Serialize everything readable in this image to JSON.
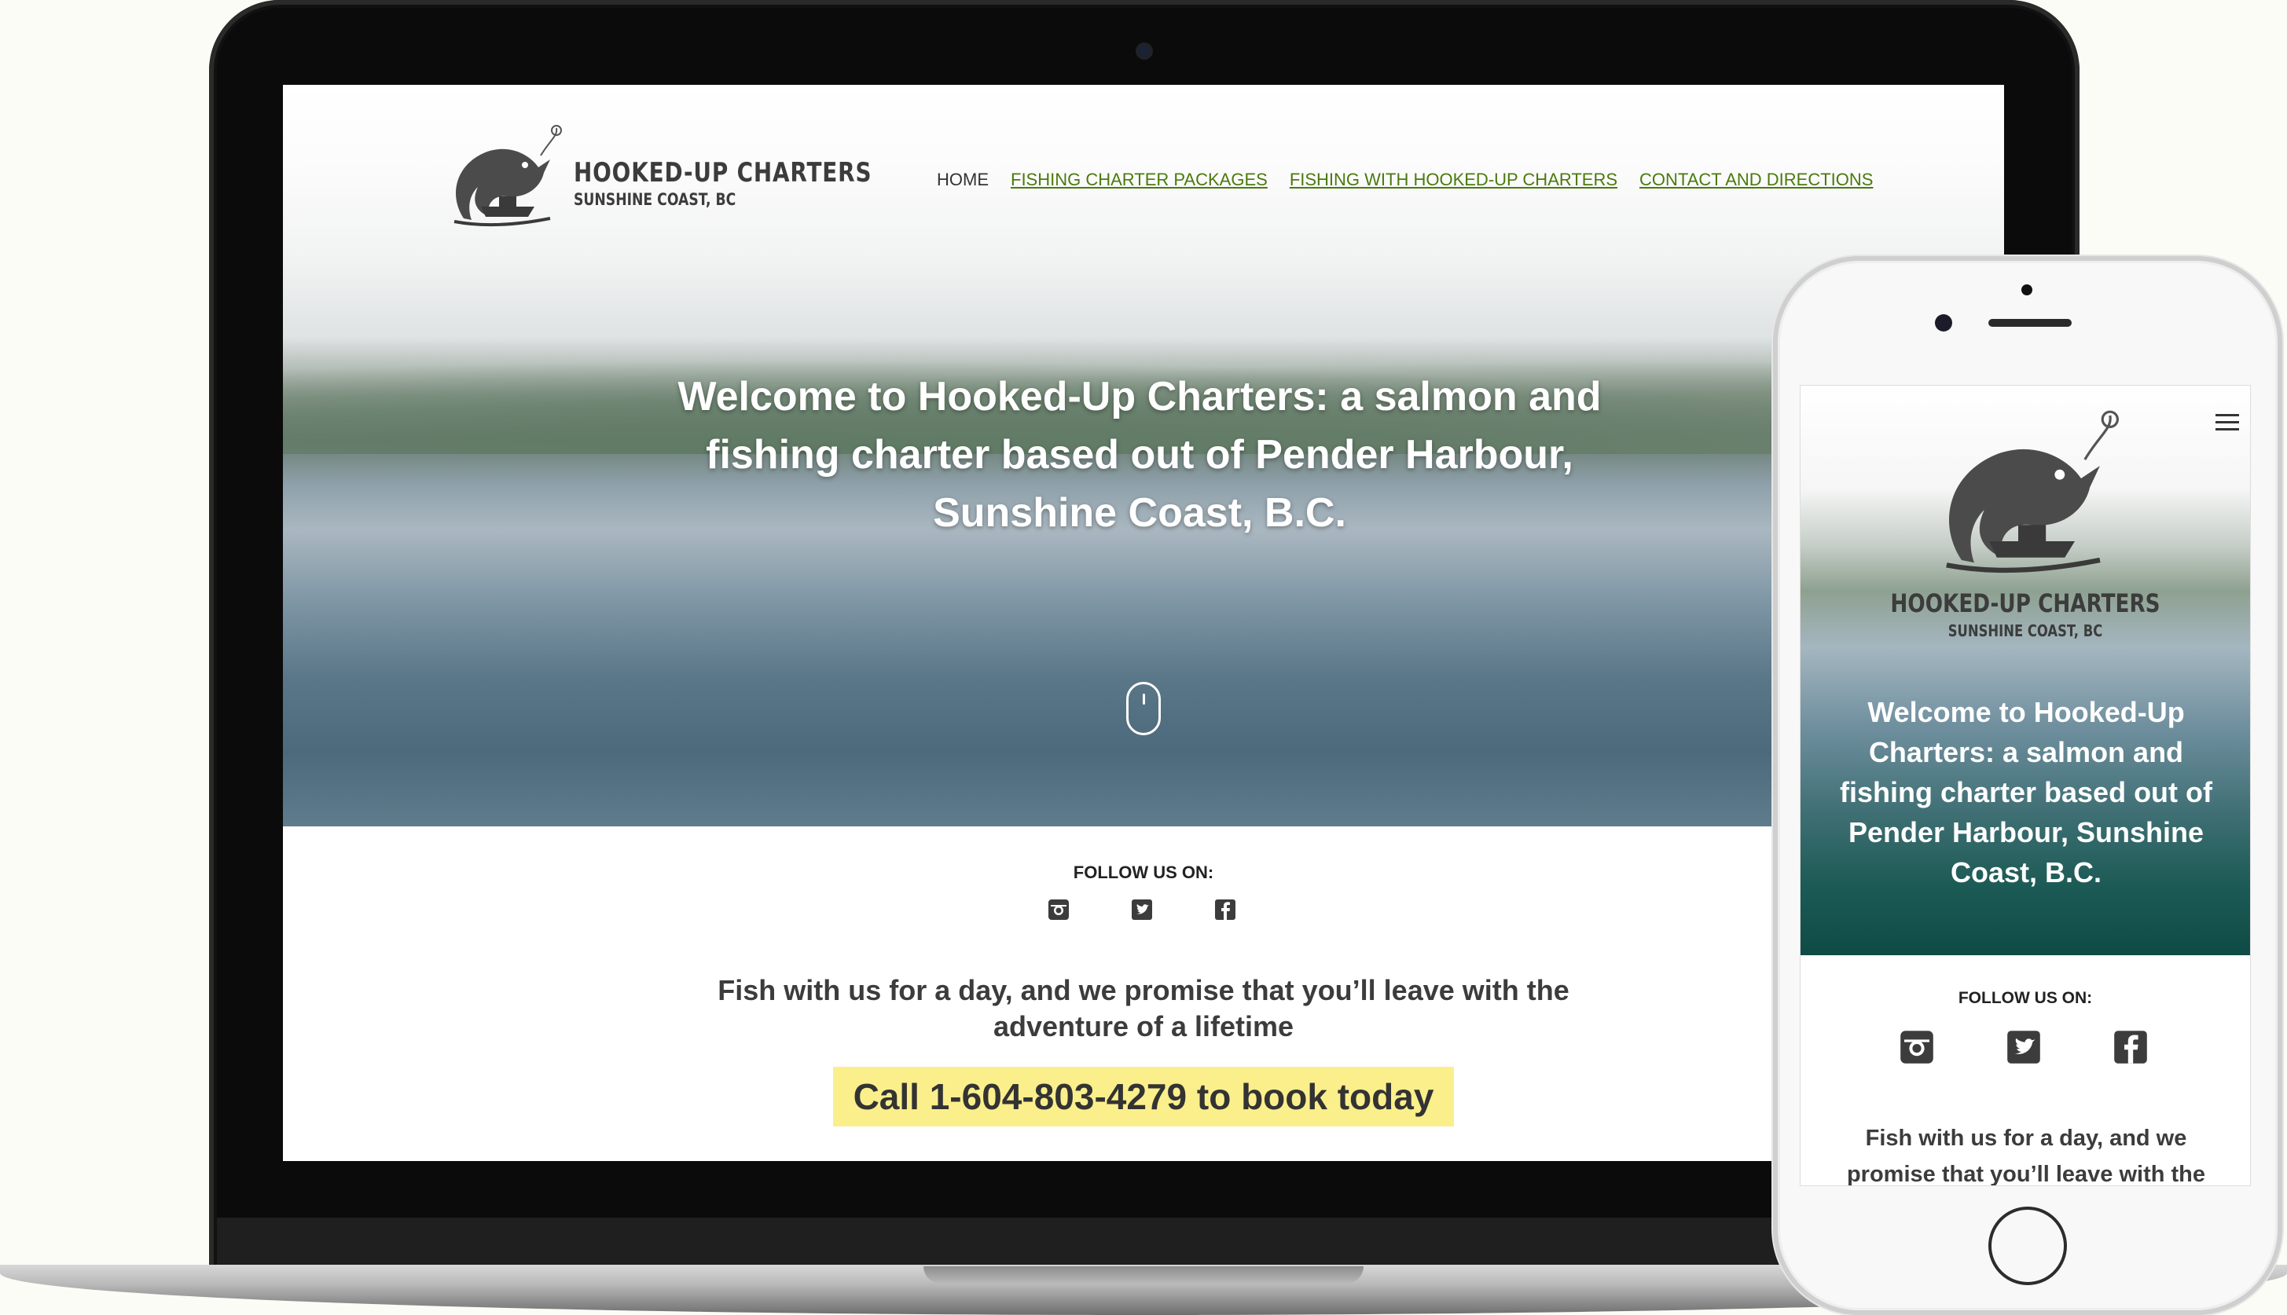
{
  "site": {
    "logo": {
      "name": "HOOKED-UP CHARTERS",
      "subtitle": "SUNSHINE COAST, BC"
    },
    "nav": [
      {
        "label": "HOME",
        "active": true
      },
      {
        "label": "FISHING CHARTER PACKAGES",
        "active": false
      },
      {
        "label": "FISHING WITH HOOKED-UP CHARTERS",
        "active": false
      },
      {
        "label": "CONTACT AND DIRECTIONS",
        "active": false
      }
    ],
    "hero_title": "Welcome to Hooked-Up Charters: a salmon and fishing charter based out of Pender Harbour, Sunshine Coast, B.C.",
    "follow_label": "FOLLOW US ON:",
    "social": [
      "instagram-icon",
      "twitter-icon",
      "facebook-icon"
    ],
    "tagline": "Fish with us for a day, and we promise that you’ll leave with the adventure of a lifetime",
    "cta": "Call 1-604-803-4279 to book today"
  },
  "mobile": {
    "hero_title": "Welcome to Hooked-Up Charters: a salmon and fishing charter based out of Pender Harbour, Sunshine Coast, B.C.",
    "tagline": "Fish with us for a day, and we promise that you’ll leave with the"
  },
  "colors": {
    "nav_link": "#4a7a0c",
    "cta_background": "#fbef8c",
    "text_dark": "#3c3c3c"
  }
}
